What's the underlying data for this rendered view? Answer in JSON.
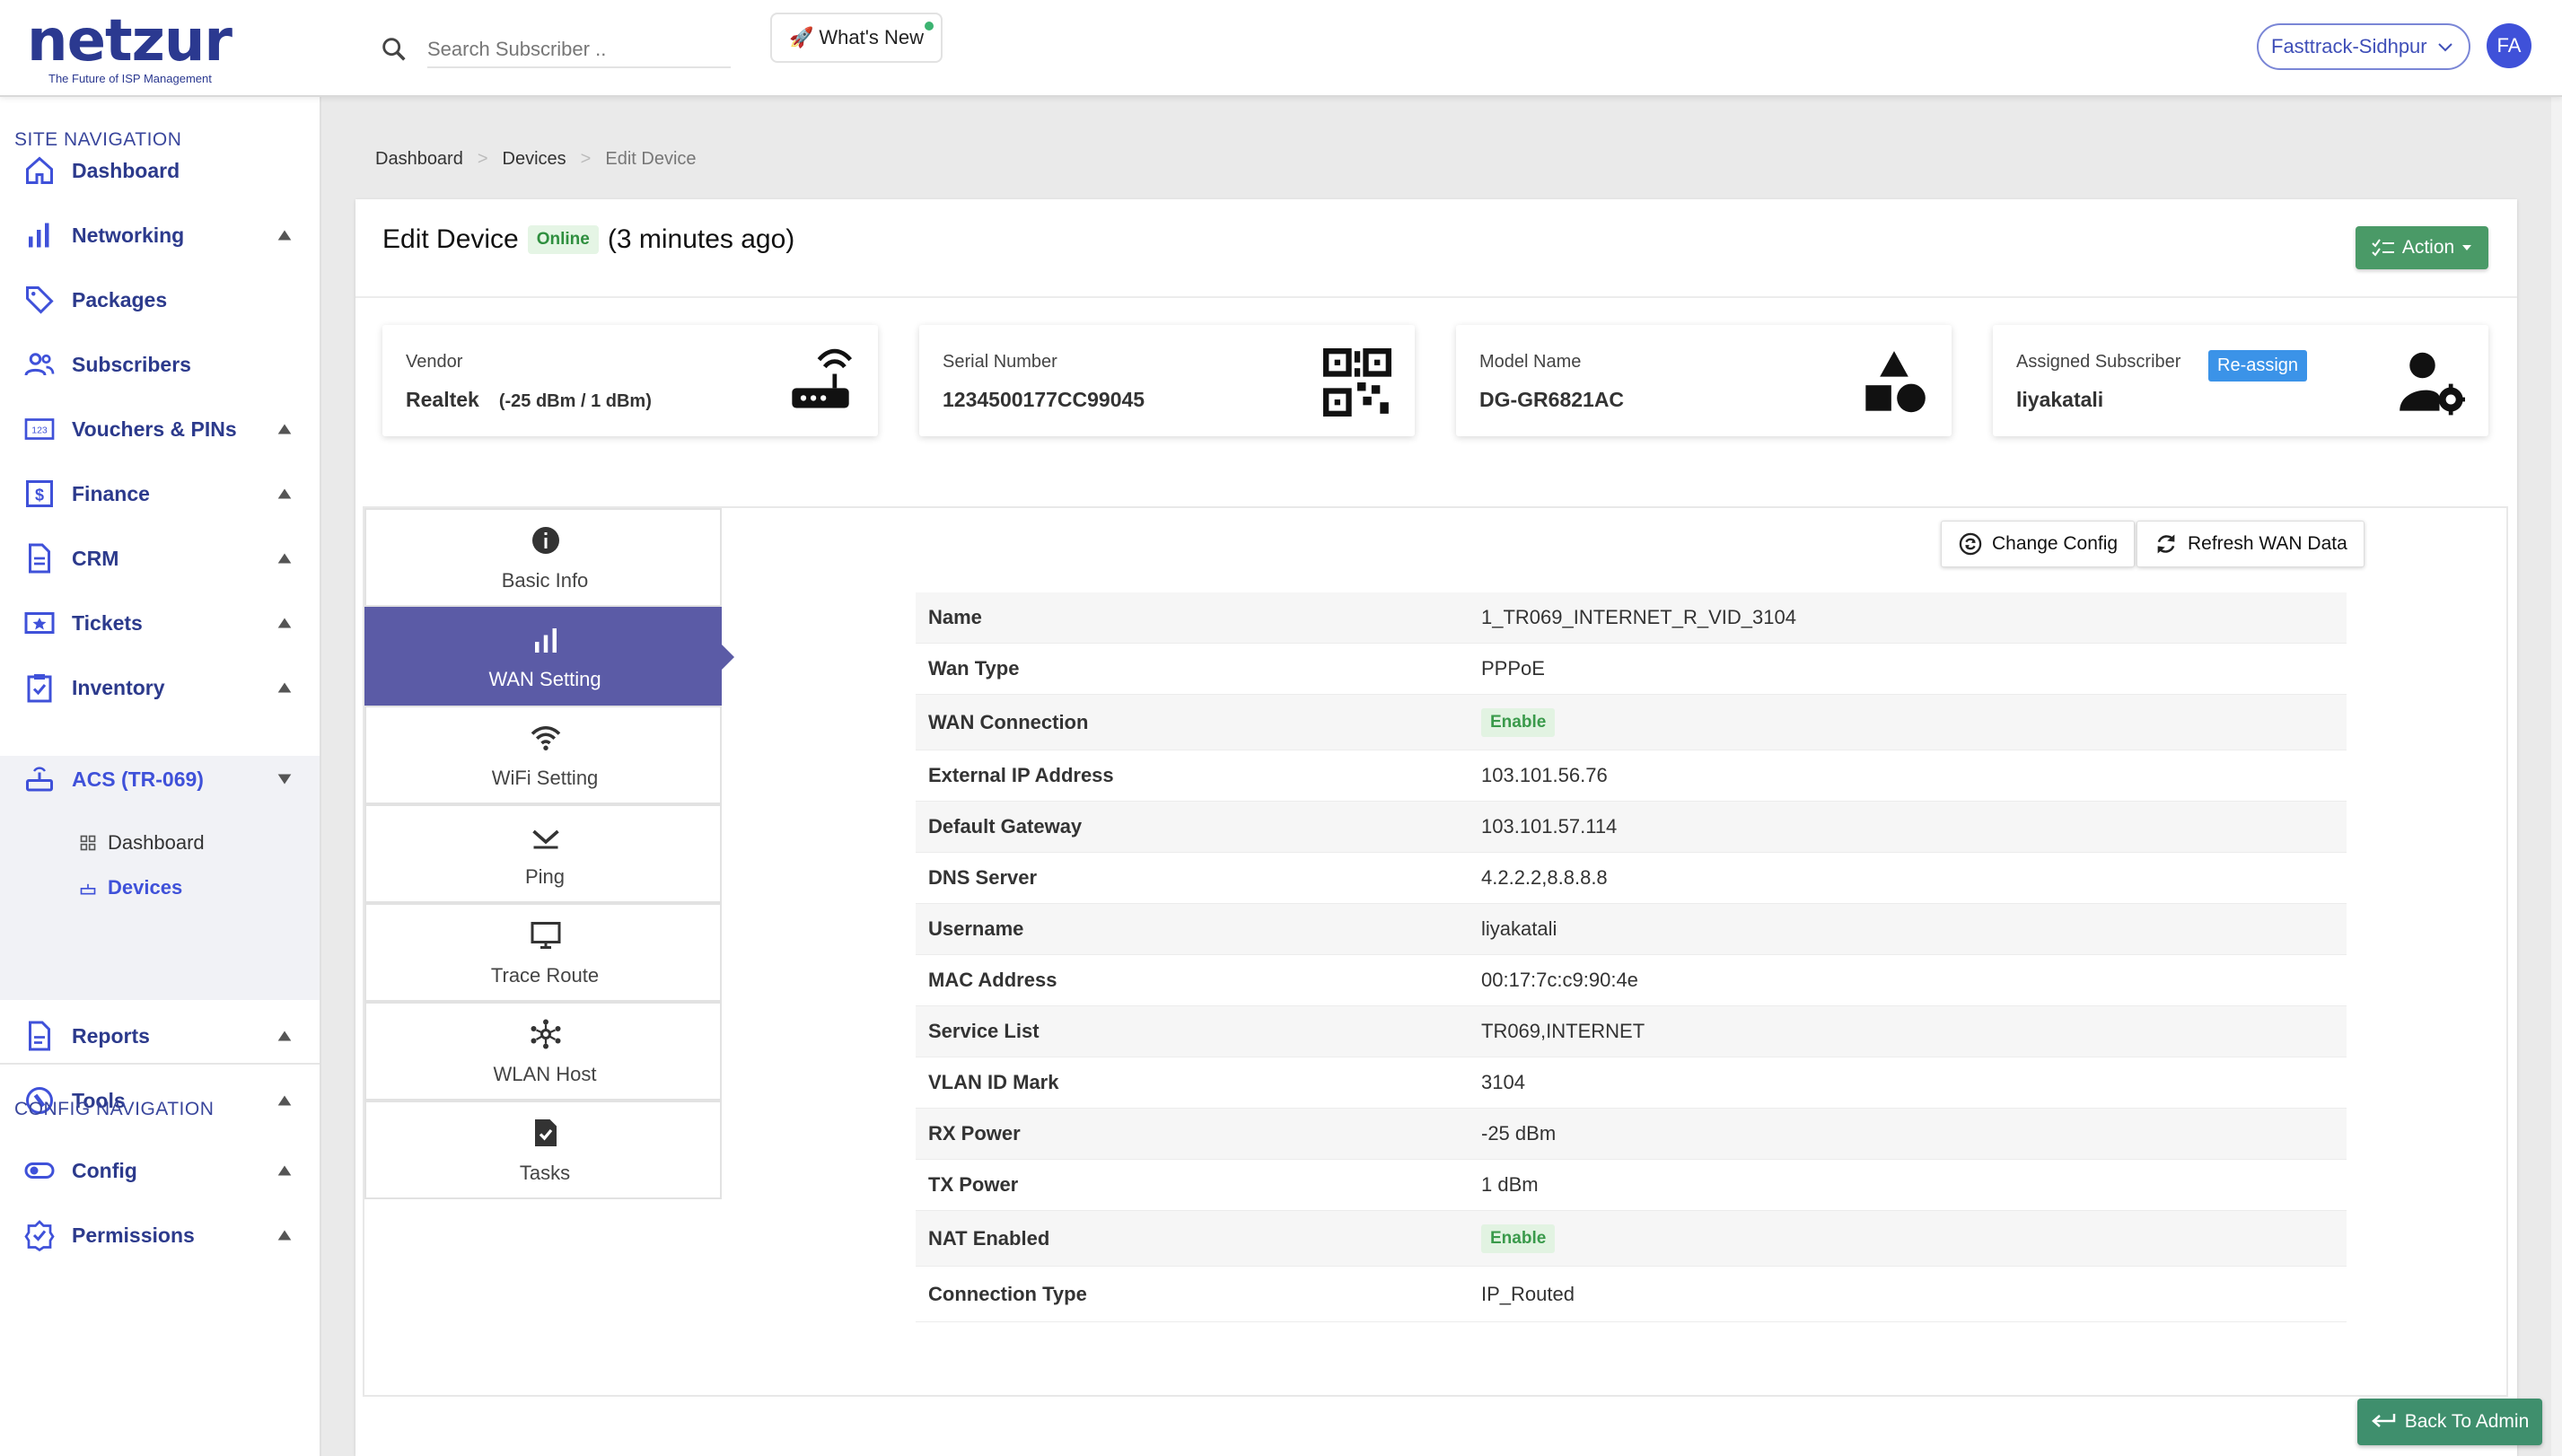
{
  "header": {
    "logo_text": "netzur",
    "logo_tagline": "The Future of ISP Management",
    "search_placeholder": "Search Subscriber ..",
    "whats_new": "What's New",
    "whats_new_icon": "🚀",
    "site_selector": "Fasttrack-Sidhpur",
    "avatar_initials": "FA"
  },
  "sidebar": {
    "site_nav_title": "SITE NAVIGATION",
    "config_nav_title": "CONFIG NAVIGATION",
    "items": [
      {
        "label": "Dashboard",
        "icon": "home-icon"
      },
      {
        "label": "Networking",
        "icon": "bar-chart-icon"
      },
      {
        "label": "Packages",
        "icon": "tag-icon"
      },
      {
        "label": "Subscribers",
        "icon": "users-icon"
      },
      {
        "label": "Vouchers & PINs",
        "icon": "voucher-icon"
      },
      {
        "label": "Finance",
        "icon": "dollar-icon"
      },
      {
        "label": "CRM",
        "icon": "document-icon"
      },
      {
        "label": "Tickets",
        "icon": "ticket-icon"
      },
      {
        "label": "Inventory",
        "icon": "clipboard-icon"
      },
      {
        "label": "ACS (TR-069)",
        "icon": "router-icon"
      },
      {
        "label": "Reports",
        "icon": "report-icon"
      },
      {
        "label": "Tools",
        "icon": "wrench-icon"
      }
    ],
    "acs_sub": [
      {
        "label": "Dashboard"
      },
      {
        "label": "Devices"
      }
    ],
    "config_items": [
      {
        "label": "Config",
        "icon": "toggle-icon"
      },
      {
        "label": "Permissions",
        "icon": "badge-check-icon"
      }
    ]
  },
  "breadcrumb": [
    "Dashboard",
    "Devices",
    "Edit Device"
  ],
  "page": {
    "title": "Edit Device",
    "status": "Online",
    "last_seen": "(3 minutes ago)",
    "action_label": "Action"
  },
  "info_cards": {
    "vendor": {
      "label": "Vendor",
      "value": "Realtek",
      "sub": "(-25 dBm / 1 dBm)"
    },
    "serial": {
      "label": "Serial Number",
      "value": "1234500177CC99045"
    },
    "model": {
      "label": "Model Name",
      "value": "DG-GR6821AC"
    },
    "subscriber": {
      "label": "Assigned Subscriber",
      "value": "liyakatali",
      "reassign": "Re-assign"
    }
  },
  "tabs": [
    {
      "label": "Basic Info",
      "icon": "info-icon"
    },
    {
      "label": "WAN Setting",
      "icon": "signal-bars-icon"
    },
    {
      "label": "WiFi Setting",
      "icon": "wifi-icon"
    },
    {
      "label": "Ping",
      "icon": "ping-icon"
    },
    {
      "label": "Trace Route",
      "icon": "monitor-icon"
    },
    {
      "label": "WLAN Host",
      "icon": "network-icon"
    },
    {
      "label": "Tasks",
      "icon": "task-check-icon"
    }
  ],
  "buttons": {
    "change_config": "Change Config",
    "refresh_wan": "Refresh WAN Data",
    "back_to_admin": "Back To Admin"
  },
  "wan": [
    {
      "key": "Name",
      "value": "1_TR069_INTERNET_R_VID_3104"
    },
    {
      "key": "Wan Type",
      "value": "PPPoE"
    },
    {
      "key": "WAN Connection",
      "value": "Enable",
      "badge": true
    },
    {
      "key": "External IP Address",
      "value": "103.101.56.76"
    },
    {
      "key": "Default Gateway",
      "value": "103.101.57.114"
    },
    {
      "key": "DNS Server",
      "value": "4.2.2.2,8.8.8.8"
    },
    {
      "key": "Username",
      "value": "liyakatali"
    },
    {
      "key": "MAC Address",
      "value": "00:17:7c:c9:90:4e"
    },
    {
      "key": "Service List",
      "value": "TR069,INTERNET"
    },
    {
      "key": "VLAN ID Mark",
      "value": "3104"
    },
    {
      "key": "RX Power",
      "value": "-25 dBm"
    },
    {
      "key": "TX Power",
      "value": "1 dBm"
    },
    {
      "key": "NAT Enabled",
      "value": "Enable",
      "badge": true
    },
    {
      "key": "Connection Type",
      "value": "IP_Routed"
    }
  ],
  "colors": {
    "brand": "#2b3990",
    "accent": "#3f51d9",
    "tab_active": "#5b5ba6",
    "action_green": "#4a9a67",
    "online_green": "#2f8f3f"
  }
}
